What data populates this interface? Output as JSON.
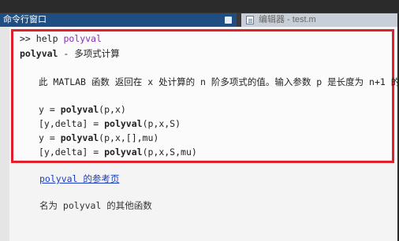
{
  "window": {
    "command_window_title": "命令行窗口",
    "editor_tab_label": "编辑器 - test.m"
  },
  "console": {
    "prompt": ">>",
    "command": "help",
    "command_arg": "polyval",
    "help_title_name": "polyval",
    "help_title_desc": " - 多项式计算",
    "description": "此 MATLAB 函数 返回在 x 处计算的 n 阶多项式的值。输入参数 p 是长度为 n+1 的",
    "syntax": [
      {
        "lhs": "y = ",
        "fn": "polyval",
        "args": "(p,x)"
      },
      {
        "lhs": "[y,delta] = ",
        "fn": "polyval",
        "args": "(p,x,S)"
      },
      {
        "lhs": "y = ",
        "fn": "polyval",
        "args": "(p,x,[],mu)"
      },
      {
        "lhs": "[y,delta] = ",
        "fn": "polyval",
        "args": "(p,x,S,mu)"
      }
    ],
    "ref_link": "polyval 的参考页",
    "other_functions": "名为 polyval 的其他函数"
  }
}
